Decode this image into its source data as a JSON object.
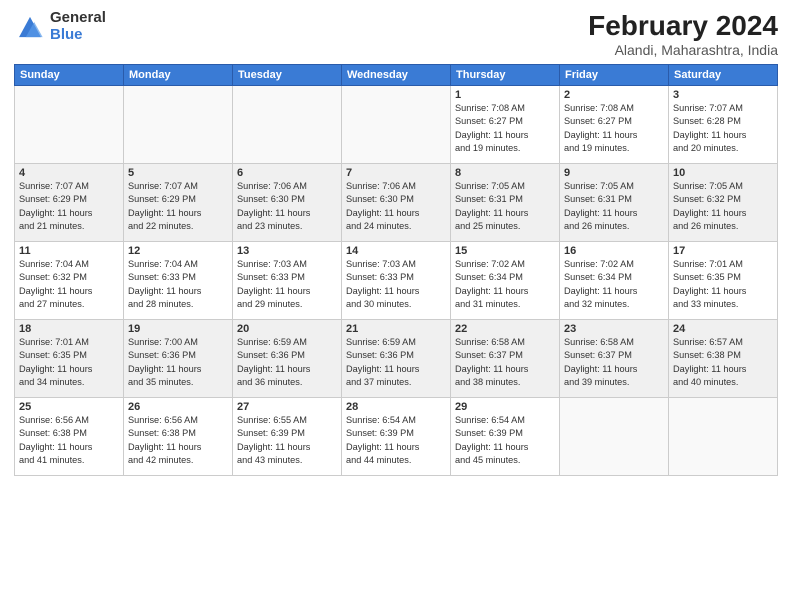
{
  "logo": {
    "general": "General",
    "blue": "Blue"
  },
  "title": "February 2024",
  "location": "Alandi, Maharashtra, India",
  "weekdays": [
    "Sunday",
    "Monday",
    "Tuesday",
    "Wednesday",
    "Thursday",
    "Friday",
    "Saturday"
  ],
  "weeks": [
    [
      {
        "day": "",
        "info": ""
      },
      {
        "day": "",
        "info": ""
      },
      {
        "day": "",
        "info": ""
      },
      {
        "day": "",
        "info": ""
      },
      {
        "day": "1",
        "info": "Sunrise: 7:08 AM\nSunset: 6:27 PM\nDaylight: 11 hours\nand 19 minutes."
      },
      {
        "day": "2",
        "info": "Sunrise: 7:08 AM\nSunset: 6:27 PM\nDaylight: 11 hours\nand 19 minutes."
      },
      {
        "day": "3",
        "info": "Sunrise: 7:07 AM\nSunset: 6:28 PM\nDaylight: 11 hours\nand 20 minutes."
      }
    ],
    [
      {
        "day": "4",
        "info": "Sunrise: 7:07 AM\nSunset: 6:29 PM\nDaylight: 11 hours\nand 21 minutes."
      },
      {
        "day": "5",
        "info": "Sunrise: 7:07 AM\nSunset: 6:29 PM\nDaylight: 11 hours\nand 22 minutes."
      },
      {
        "day": "6",
        "info": "Sunrise: 7:06 AM\nSunset: 6:30 PM\nDaylight: 11 hours\nand 23 minutes."
      },
      {
        "day": "7",
        "info": "Sunrise: 7:06 AM\nSunset: 6:30 PM\nDaylight: 11 hours\nand 24 minutes."
      },
      {
        "day": "8",
        "info": "Sunrise: 7:05 AM\nSunset: 6:31 PM\nDaylight: 11 hours\nand 25 minutes."
      },
      {
        "day": "9",
        "info": "Sunrise: 7:05 AM\nSunset: 6:31 PM\nDaylight: 11 hours\nand 26 minutes."
      },
      {
        "day": "10",
        "info": "Sunrise: 7:05 AM\nSunset: 6:32 PM\nDaylight: 11 hours\nand 26 minutes."
      }
    ],
    [
      {
        "day": "11",
        "info": "Sunrise: 7:04 AM\nSunset: 6:32 PM\nDaylight: 11 hours\nand 27 minutes."
      },
      {
        "day": "12",
        "info": "Sunrise: 7:04 AM\nSunset: 6:33 PM\nDaylight: 11 hours\nand 28 minutes."
      },
      {
        "day": "13",
        "info": "Sunrise: 7:03 AM\nSunset: 6:33 PM\nDaylight: 11 hours\nand 29 minutes."
      },
      {
        "day": "14",
        "info": "Sunrise: 7:03 AM\nSunset: 6:33 PM\nDaylight: 11 hours\nand 30 minutes."
      },
      {
        "day": "15",
        "info": "Sunrise: 7:02 AM\nSunset: 6:34 PM\nDaylight: 11 hours\nand 31 minutes."
      },
      {
        "day": "16",
        "info": "Sunrise: 7:02 AM\nSunset: 6:34 PM\nDaylight: 11 hours\nand 32 minutes."
      },
      {
        "day": "17",
        "info": "Sunrise: 7:01 AM\nSunset: 6:35 PM\nDaylight: 11 hours\nand 33 minutes."
      }
    ],
    [
      {
        "day": "18",
        "info": "Sunrise: 7:01 AM\nSunset: 6:35 PM\nDaylight: 11 hours\nand 34 minutes."
      },
      {
        "day": "19",
        "info": "Sunrise: 7:00 AM\nSunset: 6:36 PM\nDaylight: 11 hours\nand 35 minutes."
      },
      {
        "day": "20",
        "info": "Sunrise: 6:59 AM\nSunset: 6:36 PM\nDaylight: 11 hours\nand 36 minutes."
      },
      {
        "day": "21",
        "info": "Sunrise: 6:59 AM\nSunset: 6:36 PM\nDaylight: 11 hours\nand 37 minutes."
      },
      {
        "day": "22",
        "info": "Sunrise: 6:58 AM\nSunset: 6:37 PM\nDaylight: 11 hours\nand 38 minutes."
      },
      {
        "day": "23",
        "info": "Sunrise: 6:58 AM\nSunset: 6:37 PM\nDaylight: 11 hours\nand 39 minutes."
      },
      {
        "day": "24",
        "info": "Sunrise: 6:57 AM\nSunset: 6:38 PM\nDaylight: 11 hours\nand 40 minutes."
      }
    ],
    [
      {
        "day": "25",
        "info": "Sunrise: 6:56 AM\nSunset: 6:38 PM\nDaylight: 11 hours\nand 41 minutes."
      },
      {
        "day": "26",
        "info": "Sunrise: 6:56 AM\nSunset: 6:38 PM\nDaylight: 11 hours\nand 42 minutes."
      },
      {
        "day": "27",
        "info": "Sunrise: 6:55 AM\nSunset: 6:39 PM\nDaylight: 11 hours\nand 43 minutes."
      },
      {
        "day": "28",
        "info": "Sunrise: 6:54 AM\nSunset: 6:39 PM\nDaylight: 11 hours\nand 44 minutes."
      },
      {
        "day": "29",
        "info": "Sunrise: 6:54 AM\nSunset: 6:39 PM\nDaylight: 11 hours\nand 45 minutes."
      },
      {
        "day": "",
        "info": ""
      },
      {
        "day": "",
        "info": ""
      }
    ]
  ]
}
